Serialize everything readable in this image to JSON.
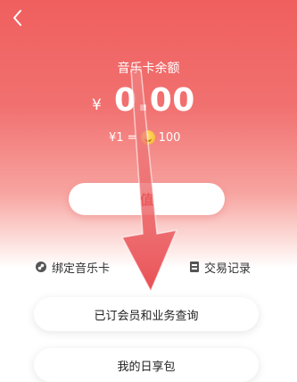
{
  "header": {
    "back_icon": "chevron-left-icon",
    "title": "音乐卡余额"
  },
  "balance": {
    "currency": "¥",
    "amount": "0.00"
  },
  "rate": {
    "left": "¥1 =",
    "coin_icon": "coin-icon",
    "right": "100"
  },
  "recharge": {
    "label": "值"
  },
  "links": {
    "bind_card": "绑定音乐卡",
    "records": "交易记录"
  },
  "cards": {
    "membership_query": "已订会员和业务查询",
    "daily_pack": "我的日享包"
  },
  "colors": {
    "hero_top": "#ef5f5e",
    "accent": "#e53935",
    "annotation_arrow": "#e8454a"
  }
}
